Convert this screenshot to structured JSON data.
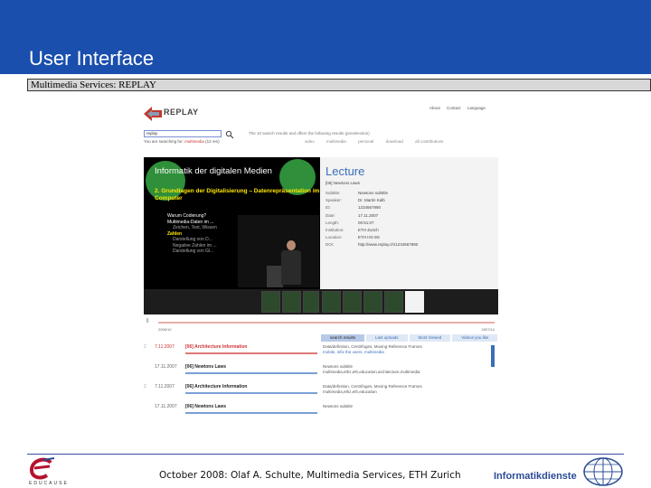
{
  "slide": {
    "title": "User Interface",
    "subtitle": "Multimedia Services: REPLAY",
    "footer": "October 2008: Olaf A. Schulte, Multimedia Services, ETH Zurich",
    "left_logo_text": "EDUCAUSE",
    "right_logo_text": "Informatikdienste"
  },
  "app": {
    "logo_text": "REPLAY",
    "top_links": [
      "About",
      "Contact",
      "Language"
    ],
    "search": {
      "value": "replay"
    },
    "search_info": {
      "prefix": "You are searching for:",
      "highlight": "multimedia",
      "count": "(12 res)"
    },
    "result_note": "The 10 search results and offers the following results (preselection)",
    "category_tabs": [
      "video",
      "multimedia",
      "personal",
      "download",
      "all contributions"
    ]
  },
  "video": {
    "title": "Informatik der digitalen Medien",
    "heading_num": "2.",
    "heading": "Grundlagen der Digitalisierung – Datenrepräsentation im Computer",
    "bullets": [
      {
        "text": "Warum Codierung?",
        "kind": "main"
      },
      {
        "text": "Multimedia-Daten im ...",
        "kind": "main"
      },
      {
        "text": "Zeichen, Text, Wissen",
        "kind": "sub"
      },
      {
        "text": "Zahlen",
        "kind": "zahl"
      },
      {
        "text": "Darstellung von D...",
        "kind": "sub"
      },
      {
        "text": "Negative Zahlen im ...",
        "kind": "sub"
      },
      {
        "text": "Darstellung von Gl...",
        "kind": "sub"
      }
    ]
  },
  "lecture": {
    "heading": "Lecture",
    "subtitle": "[06] Newtons Laws",
    "fields": [
      {
        "key": "Subtitle:",
        "value": "Newtons subtitle"
      },
      {
        "key": "Speaker:",
        "value": "Dr. Martin Kalb"
      },
      {
        "key": "ID:",
        "value": "1234567890"
      },
      {
        "key": "Date:",
        "value": "17.11.2007"
      },
      {
        "key": "Length:",
        "value": "00:51:07"
      },
      {
        "key": "Institution:",
        "value": "ETH Zurich"
      },
      {
        "key": "Location:",
        "value": "ETH HG E5"
      },
      {
        "key": "DOI:",
        "value": "http://www.replay.ch/1234567890"
      }
    ]
  },
  "timeline": {
    "handle": "||",
    "start": "2006/10",
    "end": "2007/10"
  },
  "results": {
    "tabs": [
      "search results",
      "Last uploads",
      "Most Viewed",
      "Videos you like"
    ],
    "rows": [
      {
        "pre": "2",
        "date": "7.11.2007",
        "title": "[06] Architecture Information",
        "snippet1": "Data/definition, Centrifuges, Moving Reference Frames",
        "snippet2": "mobile, infix the users, multimedia",
        "highlight": true
      },
      {
        "pre": "",
        "date": "17.11.2007",
        "title": "[06] Newtons Laws",
        "snippet1": "Newtons subtitle",
        "snippet2": "multimedia,ethz,eth,education,architecture,multimedia",
        "highlight": false
      },
      {
        "pre": "2",
        "date": "7.11.2007",
        "title": "[06] Architecture Information",
        "snippet1": "Data/definition, Centrifuges, Moving Reference Frames",
        "snippet2": "multimedia,ethz,eth,education",
        "highlight": false
      },
      {
        "pre": "",
        "date": "17.11.2007",
        "title": "[06] Newtons Laws",
        "snippet1": "Newtons subtitle",
        "snippet2": "",
        "highlight": false
      }
    ]
  },
  "colors": {
    "header_blue": "#1a4fad",
    "accent_red": "#c33333",
    "link_blue": "#3a6fb8"
  }
}
